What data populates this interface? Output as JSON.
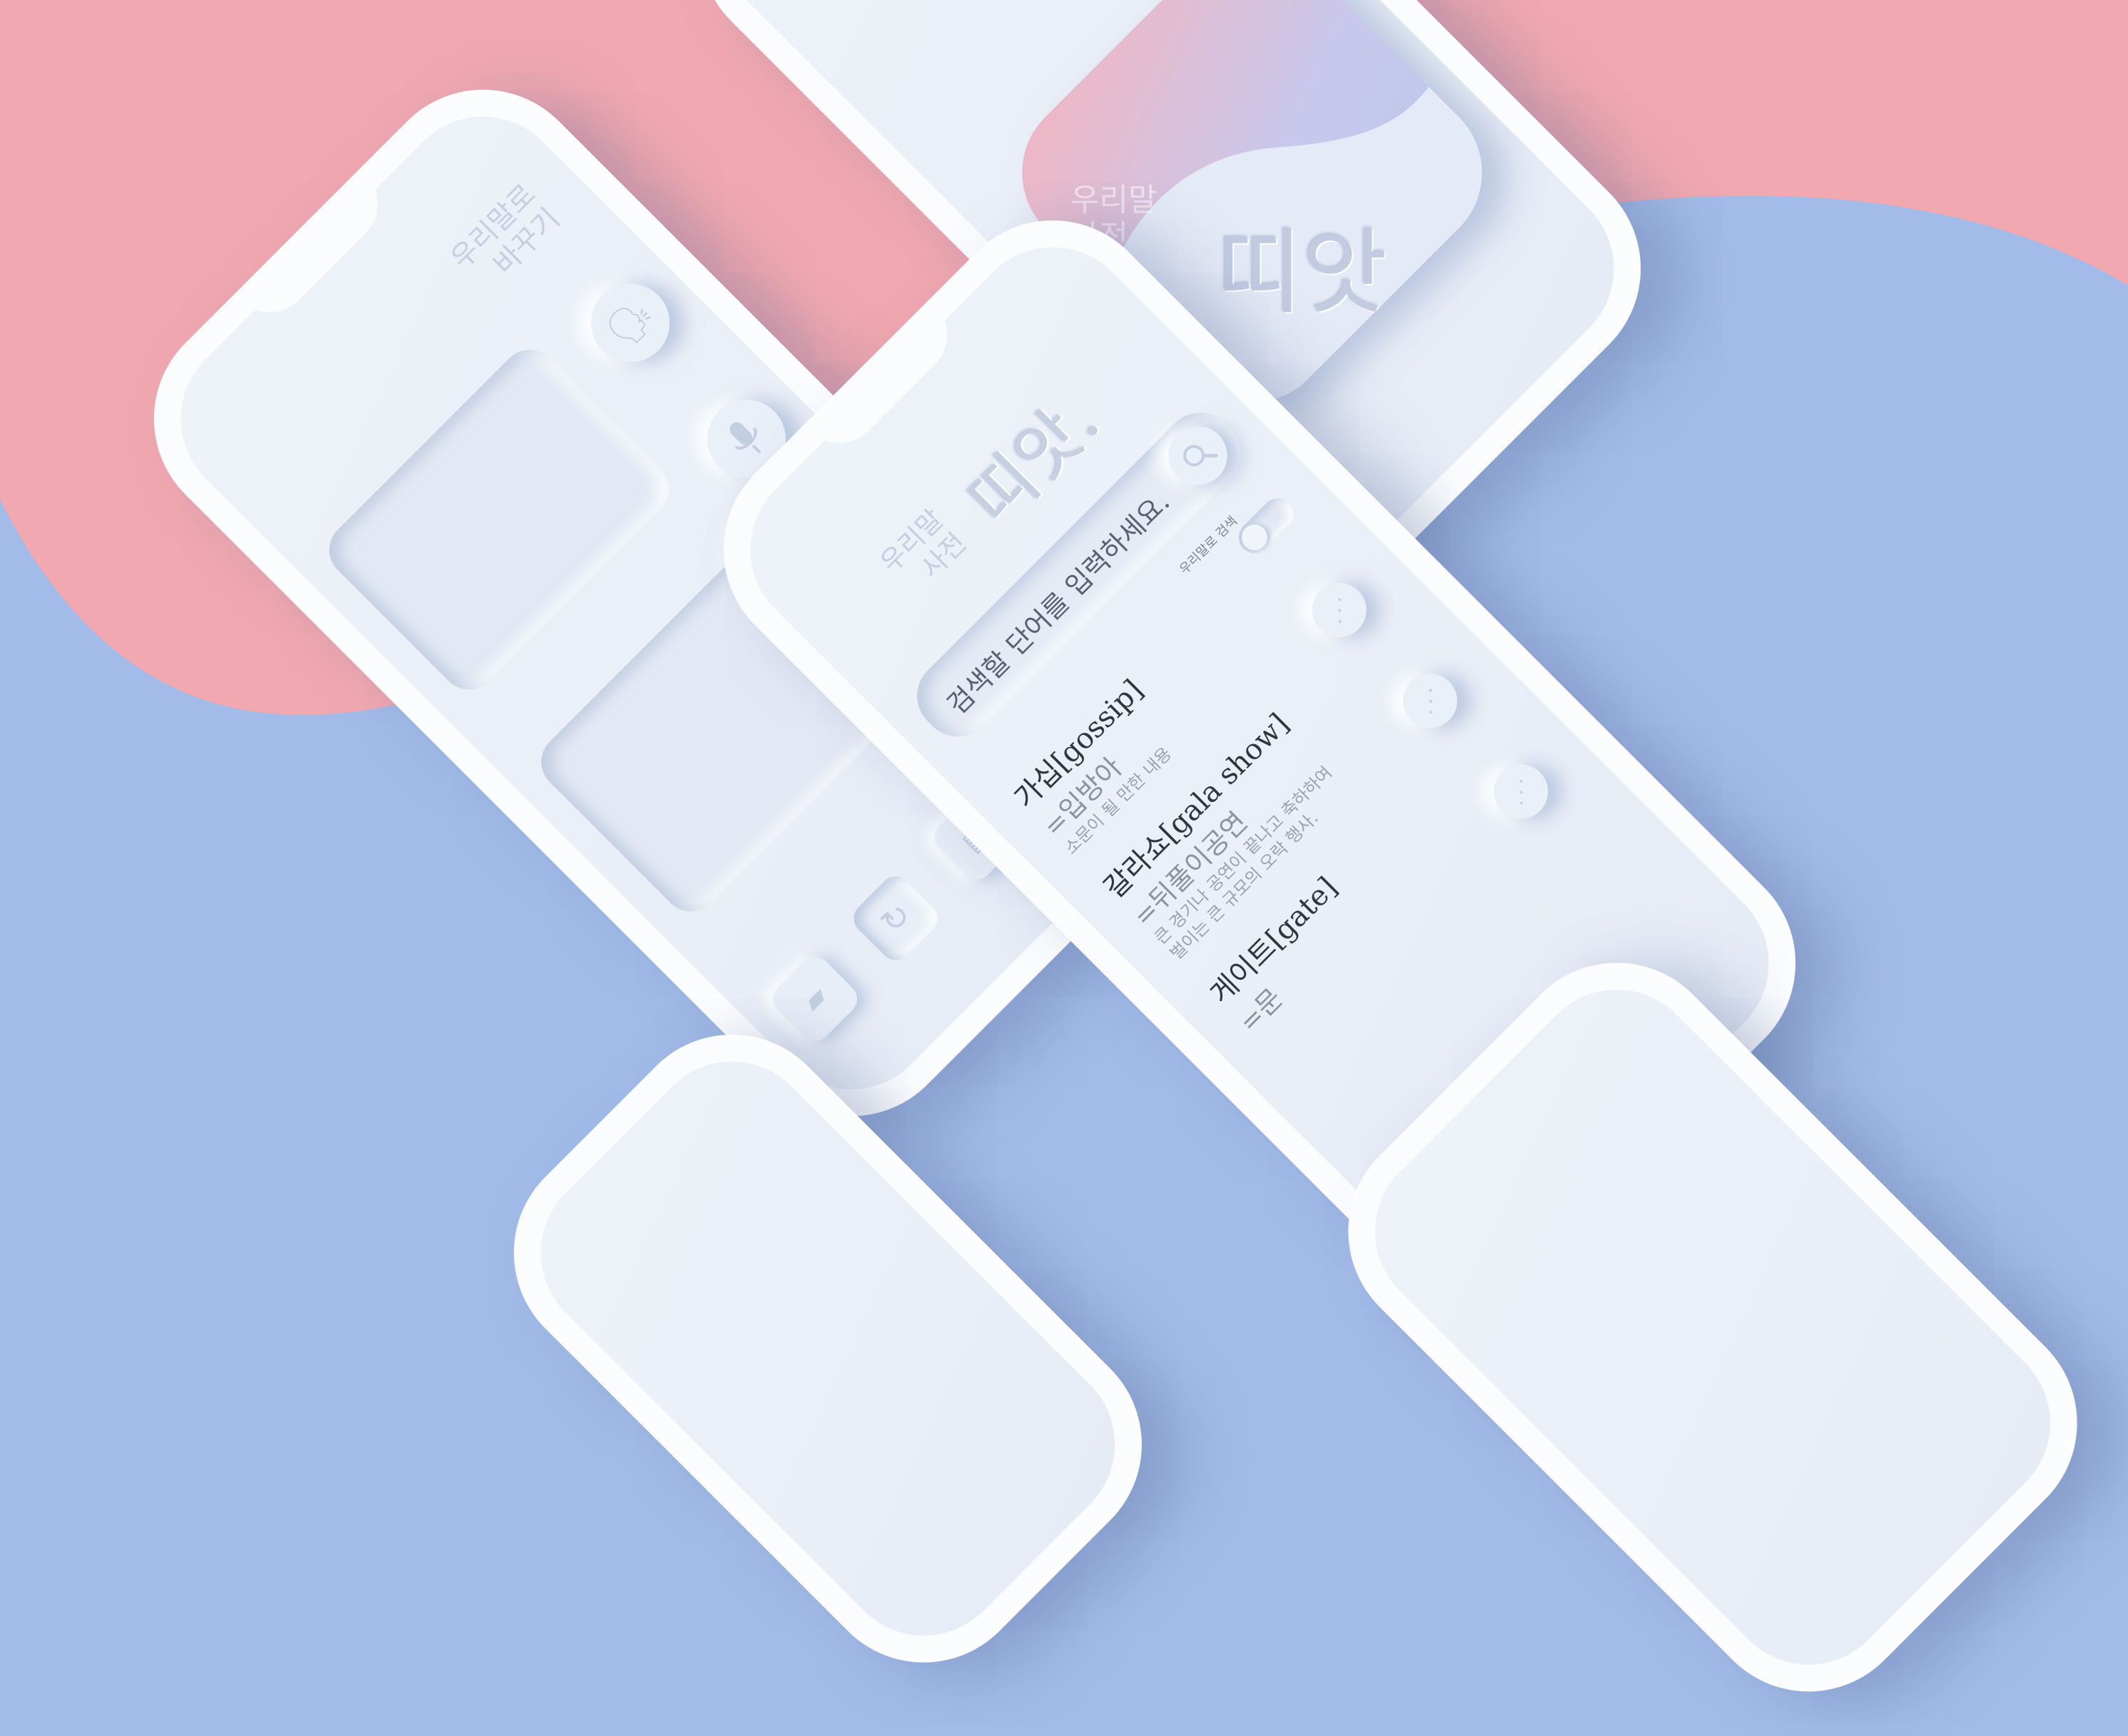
{
  "colors": {
    "pink": "#f1a8b0",
    "blue": "#a3bbe8",
    "device": "#fbfcfe",
    "screen": "#eaeff8"
  },
  "app": {
    "logo_text": "띠앗.",
    "subtitle_line1": "우리말",
    "subtitle_line2": "사전"
  },
  "translate_screen": {
    "title_line1": "우리말로",
    "title_line2": "바꾸기",
    "icons": [
      "speaker-icon",
      "microphone-icon",
      "swap-icon"
    ],
    "tabs": [
      "book-icon",
      "refresh-icon",
      "note-icon",
      "grid-icon"
    ]
  },
  "dictionary_screen": {
    "title_line1": "우리말",
    "title_line2": "사전",
    "logo": "띠앗.",
    "search_placeholder": "검색할 단어를 입력하세요.",
    "toggle_label": "우리말로 검색",
    "results": [
      {
        "word": "가십[gossip]",
        "synonym": "=입방아",
        "definition": [
          "소문이 될 만한 내용"
        ]
      },
      {
        "word": "갈라쇼[gala show]",
        "synonym": "=뒤풀이공연",
        "definition": [
          "큰 경기나 공연이 끝나고 축하하여",
          "벌이는 큰 규모의 오락 행사."
        ]
      },
      {
        "word": "게이트[gate]",
        "synonym": "=문",
        "definition": []
      }
    ]
  }
}
